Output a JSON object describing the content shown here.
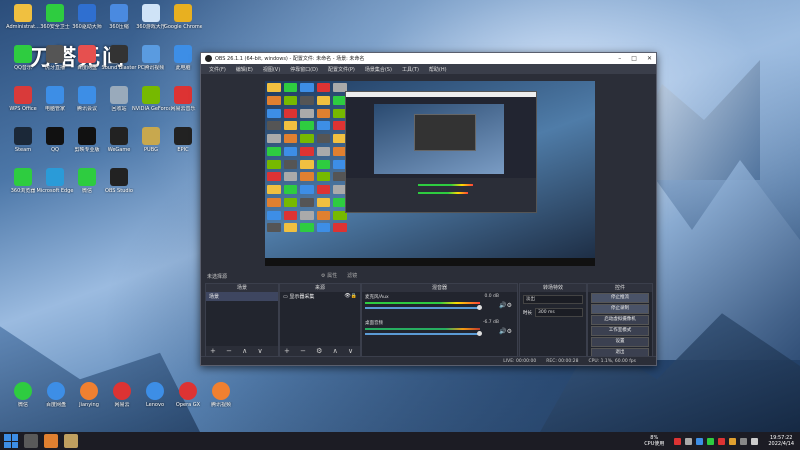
{
  "desktop": {
    "logo_text": "刀塔无间",
    "icons": [
      {
        "label": "Administrat...",
        "color": "#f0c040"
      },
      {
        "label": "360安全卫士",
        "color": "#2ecc40"
      },
      {
        "label": "360驱动大师",
        "color": "#2f6fd0"
      },
      {
        "label": "360压缩",
        "color": "#4a8ae0"
      },
      {
        "label": "360游戏大厅",
        "color": "#cfe3f7"
      },
      {
        "label": "Google Chrome",
        "color": "#e8b020"
      },
      {
        "label": "QQ音乐",
        "color": "#2ecc40"
      },
      {
        "label": "虎牙直播",
        "color": "#555"
      },
      {
        "label": "百度网盘",
        "color": "#e6504f"
      },
      {
        "label": "Sound Blaster",
        "color": "#333"
      },
      {
        "label": "PC腾讯视频",
        "color": "#5a9be0"
      },
      {
        "label": "此电脑",
        "color": "#3d8ee6"
      },
      {
        "label": "WPS Office",
        "color": "#d93a3a"
      },
      {
        "label": "电脑管家",
        "color": "#3d8ee6"
      },
      {
        "label": "腾讯会议",
        "color": "#3d8ee6"
      },
      {
        "label": "回收站",
        "color": "#9ab"
      },
      {
        "label": "NVIDIA GeForce",
        "color": "#76b900"
      },
      {
        "label": "网易云音乐",
        "color": "#d33"
      },
      {
        "label": "Steam",
        "color": "#1b2838"
      },
      {
        "label": "QQ",
        "color": "#111"
      },
      {
        "label": "剪映专业版",
        "color": "#111"
      },
      {
        "label": "WeGame",
        "color": "#222"
      },
      {
        "label": "PUBG",
        "color": "#c8a84e"
      },
      {
        "label": "EPIC",
        "color": "#222"
      },
      {
        "label": "360浏览器",
        "color": "#2ecc40"
      },
      {
        "label": "Microsoft Edge",
        "color": "#2a9bd8"
      },
      {
        "label": "微信",
        "color": "#2ecc40"
      },
      {
        "label": "OBS Studio",
        "color": "#222"
      }
    ],
    "bottom_icons": [
      {
        "label": "微信",
        "color": "#2ecc40"
      },
      {
        "label": "百度网盘",
        "color": "#3d8ee6"
      },
      {
        "label": "Jianying",
        "color": "#f08030"
      },
      {
        "label": "网易云",
        "color": "#d33"
      },
      {
        "label": "Lenovo",
        "color": "#3d8ee6"
      },
      {
        "label": "Opera GX",
        "color": "#d33"
      },
      {
        "label": "腾讯视频",
        "color": "#f08030"
      }
    ]
  },
  "obs": {
    "title": "OBS 26.1.1 (64-bit, windows) - 配置文件: 未命名 - 场景: 未命名",
    "menu": [
      "文件(F)",
      "编辑(E)",
      "视图(V)",
      "停靠窗口(D)",
      "配置文件(P)",
      "场景集合(S)",
      "工具(T)",
      "帮助(H)"
    ],
    "scene_label": "未选择源",
    "mini_tabs": [
      "⚙ 属性",
      "滤镜"
    ],
    "docks": {
      "scenes": {
        "title": "场景",
        "items": [
          "场景"
        ],
        "footer": "+ − ∧ ∨"
      },
      "sources": {
        "title": "来源",
        "items": [
          "显示器采集"
        ],
        "footer": "+ − ⚙ ∧ ∨"
      },
      "mixer": {
        "title": "混音器",
        "channels": [
          {
            "name": "麦克风/Aux",
            "db": "0.0 dB"
          },
          {
            "name": "桌面音频",
            "db": "-6.7 dB"
          }
        ]
      },
      "transitions": {
        "title": "转场特效",
        "type": "淡出",
        "duration_label": "时长",
        "duration": "300 ms"
      },
      "controls": {
        "title": "控件",
        "buttons": [
          "停止推流",
          "停止录制",
          "启动虚拟摄像机",
          "工作室模式",
          "设置",
          "退出"
        ]
      }
    },
    "status": {
      "live": "LIVE: 00:00:00",
      "rec": "REC: 00:00:28",
      "cpu": "CPU: 1.1%, 60.00 fps"
    }
  },
  "taskbar": {
    "cpu_pct": "8%",
    "cpu_label": "CPU使用",
    "time": "19:57:22",
    "date": "2022/4/14",
    "items": [
      {
        "color": "#5a5a5a"
      },
      {
        "color": "#e08030"
      },
      {
        "color": "#c0a060"
      }
    ],
    "tray": [
      {
        "color": "#d33"
      },
      {
        "color": "#aaa"
      },
      {
        "color": "#3d8ee6"
      },
      {
        "color": "#2ecc40"
      },
      {
        "color": "#d33"
      },
      {
        "color": "#e0a030"
      },
      {
        "color": "#888"
      },
      {
        "color": "#ccc"
      }
    ]
  }
}
